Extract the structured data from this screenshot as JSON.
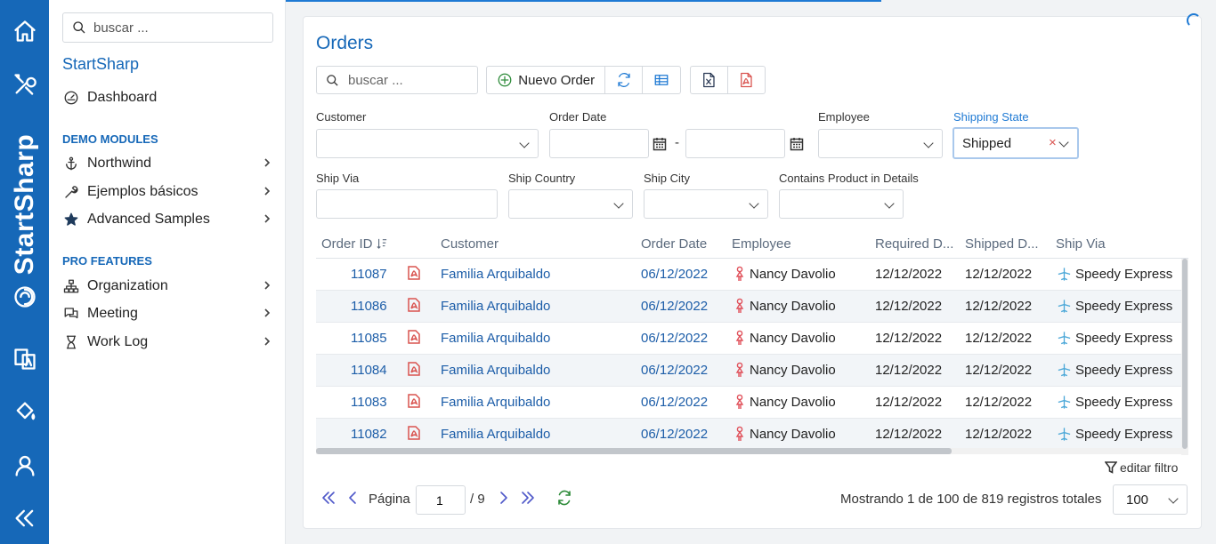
{
  "rail": {
    "brand": "StartSharp",
    "icons": [
      "home-icon",
      "tools-icon",
      "translate-icon",
      "paint-bucket-icon",
      "user-icon",
      "collapse-icon"
    ]
  },
  "sidebar": {
    "search_placeholder": "buscar ...",
    "app_title": "StartSharp",
    "dashboard": "Dashboard",
    "demo_header": "DEMO MODULES",
    "demo_items": [
      "Northwind",
      "Ejemplos básicos",
      "Advanced Samples"
    ],
    "pro_header": "PRO FEATURES",
    "pro_items": [
      "Organization",
      "Meeting",
      "Work Log"
    ]
  },
  "page": {
    "title": "Orders",
    "search_placeholder": "buscar ...",
    "new_button": "Nuevo Order"
  },
  "filters": {
    "customer": "Customer",
    "order_date": "Order Date",
    "date_separator": "-",
    "employee": "Employee",
    "shipping_state": "Shipping State",
    "shipping_state_value": "Shipped",
    "ship_via": "Ship Via",
    "ship_country": "Ship Country",
    "ship_city": "Ship City",
    "contains_product": "Contains Product in Details"
  },
  "grid": {
    "columns": [
      "Order ID",
      "Customer",
      "Order Date",
      "Employee",
      "Required D...",
      "Shipped D...",
      "Ship Via"
    ],
    "rows": [
      {
        "id": "11087",
        "customer": "Familia Arquibaldo",
        "order_date": "06/12/2022",
        "employee": "Nancy Davolio",
        "required": "12/12/2022",
        "shipped": "12/12/2022",
        "ship_via": "Speedy Express"
      },
      {
        "id": "11086",
        "customer": "Familia Arquibaldo",
        "order_date": "06/12/2022",
        "employee": "Nancy Davolio",
        "required": "12/12/2022",
        "shipped": "12/12/2022",
        "ship_via": "Speedy Express"
      },
      {
        "id": "11085",
        "customer": "Familia Arquibaldo",
        "order_date": "06/12/2022",
        "employee": "Nancy Davolio",
        "required": "12/12/2022",
        "shipped": "12/12/2022",
        "ship_via": "Speedy Express"
      },
      {
        "id": "11084",
        "customer": "Familia Arquibaldo",
        "order_date": "06/12/2022",
        "employee": "Nancy Davolio",
        "required": "12/12/2022",
        "shipped": "12/12/2022",
        "ship_via": "Speedy Express"
      },
      {
        "id": "11083",
        "customer": "Familia Arquibaldo",
        "order_date": "06/12/2022",
        "employee": "Nancy Davolio",
        "required": "12/12/2022",
        "shipped": "12/12/2022",
        "ship_via": "Speedy Express"
      },
      {
        "id": "11082",
        "customer": "Familia Arquibaldo",
        "order_date": "06/12/2022",
        "employee": "Nancy Davolio",
        "required": "12/12/2022",
        "shipped": "12/12/2022",
        "ship_via": "Speedy Express"
      }
    ],
    "edit_filter": "editar filtro"
  },
  "pager": {
    "page_label": "Página",
    "page_value": "1",
    "page_total": "/ 9",
    "status": "Mostrando 1 de 100 de 819 registros totales",
    "page_size": "100"
  },
  "colors": {
    "primary": "#1668b8",
    "link": "#1c5da8",
    "pdf": "#d9534f",
    "pager": "#4f58c9"
  }
}
